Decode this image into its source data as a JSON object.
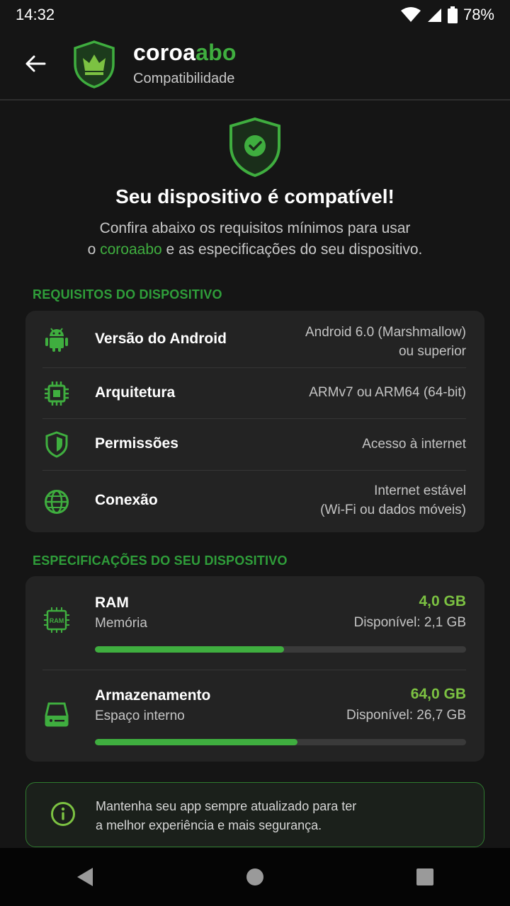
{
  "status_bar": {
    "time": "14:32",
    "battery": "78%"
  },
  "app_bar": {
    "brand_part1": "coroa",
    "brand_part2": "abo",
    "subtitle": "Compatibilidade"
  },
  "hero": {
    "title": "Seu dispositivo é compatível!",
    "desc_line1": "Confira abaixo os requisitos mínimos para usar",
    "desc_prefix": "o ",
    "desc_brand": "coroaabo",
    "desc_suffix": " e as especificações do seu dispositivo."
  },
  "requirements": {
    "title": "REQUISITOS DO DISPOSITIVO",
    "items": [
      {
        "label": "Versão do Android",
        "value_line1": "Android 6.0 (Marshmallow)",
        "value_line2": "ou superior",
        "icon": "android-icon"
      },
      {
        "label": "Arquitetura",
        "value_line1": "ARMv7 ou ARM64 (64-bit)",
        "value_line2": "",
        "icon": "chip-icon"
      },
      {
        "label": "Permissões",
        "value_line1": "Acesso à internet",
        "value_line2": "",
        "icon": "shield-icon"
      },
      {
        "label": "Conexão",
        "value_line1": "Internet estável",
        "value_line2": "(Wi-Fi ou dados móveis)",
        "icon": "globe-icon"
      }
    ]
  },
  "specs": {
    "title": "ESPECIFICAÇÕES DO SEU DISPOSITIVO",
    "items": [
      {
        "label": "RAM",
        "sub": "Memória",
        "total": "4,0 GB",
        "available": "Disponível: 2,1 GB",
        "used_fraction": 0.51,
        "icon": "ram-icon",
        "icon_text": "RAM"
      },
      {
        "label": "Armazenamento",
        "sub": "Espaço interno",
        "total": "64,0 GB",
        "available": "Disponível: 26,7 GB",
        "used_fraction": 0.545,
        "icon": "storage-icon"
      }
    ]
  },
  "info": {
    "line1": "Mantenha seu app sempre atualizado para ter",
    "line2": "a melhor experiência e mais segurança.",
    "icon": "info-icon"
  },
  "colors": {
    "accent": "#3fae3f",
    "accent_light": "#7cc242",
    "section": "#2f9e3a",
    "background": "#151515",
    "card": "#232323"
  },
  "nav": {
    "icons": [
      "back-triangle-icon",
      "home-circle-icon",
      "recents-square-icon"
    ]
  }
}
